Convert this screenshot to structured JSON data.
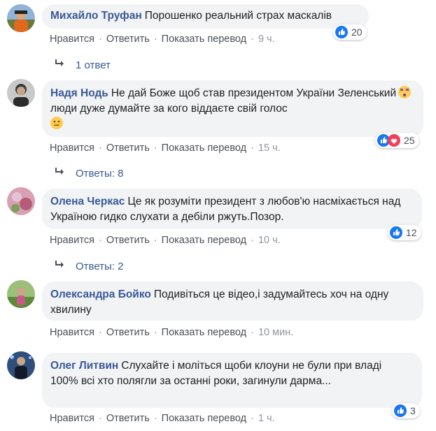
{
  "comments": [
    {
      "author": "Михайло Труфан",
      "text": "Порошенко реальний страх маскалів",
      "actions": {
        "like": "Нравится",
        "reply": "Ответить",
        "translate": "Показать перевод",
        "time": "9 ч."
      },
      "reaction_count": "20",
      "replies_label": "1 ответ"
    },
    {
      "author": "Надя Нодь",
      "text_part1": "Не дай Боже щоб став президентом України Зеленський",
      "text_part2": "люди дуже думайте за кого віддаєте свій голос",
      "actions": {
        "like": "Нравится",
        "reply": "Ответить",
        "translate": "Показать перевод",
        "time": "15 ч."
      },
      "reaction_count": "25",
      "replies_label": "Ответы: 8"
    },
    {
      "author": "Олена Черкас",
      "text": "Це як розуміти президент з любов'ю насміхається над Україною гидко слухати а дебіли ржуть.Позор.",
      "actions": {
        "like": "Нравится",
        "reply": "Ответить",
        "translate": "Показать перевод",
        "time": "10 ч."
      },
      "reaction_count": "12",
      "replies_label": "Ответы: 2"
    },
    {
      "author": "Олександра Бойко",
      "text": "Подивіться це відео,і задумайтесь хоч на одну хвилину",
      "actions": {
        "like": "Нравится",
        "reply": "Ответить",
        "translate": "Показать перевод",
        "time": "10 мин."
      }
    },
    {
      "author": "Олег Литвин",
      "text_line1": "Слухайте і моліться щоби клоуни не були при владі",
      "text_line2": "100% всі хто полягли за останні роки, загинули дарма...",
      "actions": {
        "like": "Нравится",
        "reply": "Ответить",
        "translate": "Показать перевод",
        "time": "1 ч."
      },
      "reaction_count": "3"
    }
  ],
  "colors": {
    "author": "#385898",
    "bubble": "#f2f3f5",
    "like": "#1877f2",
    "love": "#f33e58",
    "meta": "#4b4f56"
  }
}
